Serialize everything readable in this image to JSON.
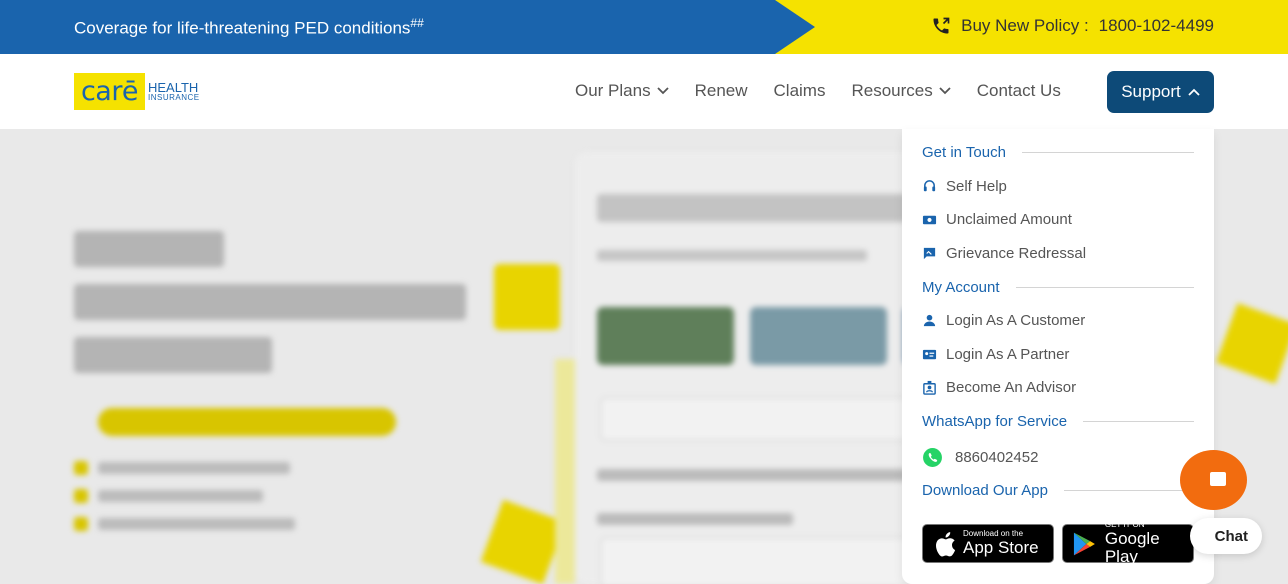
{
  "topbar": {
    "promo_text": "Coverage for life-threatening PED conditions",
    "promo_sup": "##",
    "phone_label": "Buy New Policy :",
    "phone_number": "1800-102-4499"
  },
  "logo": {
    "mark": "carē",
    "line1": "HEALTH",
    "line2": "INSURANCE"
  },
  "nav": {
    "items": [
      {
        "label": "Our Plans",
        "has_chevron": true
      },
      {
        "label": "Renew"
      },
      {
        "label": "Claims"
      },
      {
        "label": "Resources",
        "has_chevron": true
      },
      {
        "label": "Contact Us"
      }
    ],
    "support_label": "Support"
  },
  "dropdown": {
    "get_in_touch": "Get in Touch",
    "self_help": "Self Help",
    "unclaimed_amount": "Unclaimed Amount",
    "grievance": "Grievance Redressal",
    "my_account": "My Account",
    "login_customer": "Login As A Customer",
    "login_partner": "Login As A Partner",
    "become_advisor": "Become An Advisor",
    "whatsapp_head": "WhatsApp for Service",
    "whatsapp_number": "8860402452",
    "download_app": "Download Our App",
    "appstore_small": "Download on the",
    "appstore_big": "App Store",
    "playstore_small": "GET IT ON",
    "playstore_big": "Google Play"
  },
  "chat": {
    "label": "Chat"
  },
  "colors": {
    "brand_blue": "#1a64ad",
    "brand_yellow": "#f5e200",
    "support_navy": "#0d4a78",
    "chat_orange": "#f26c0f"
  }
}
